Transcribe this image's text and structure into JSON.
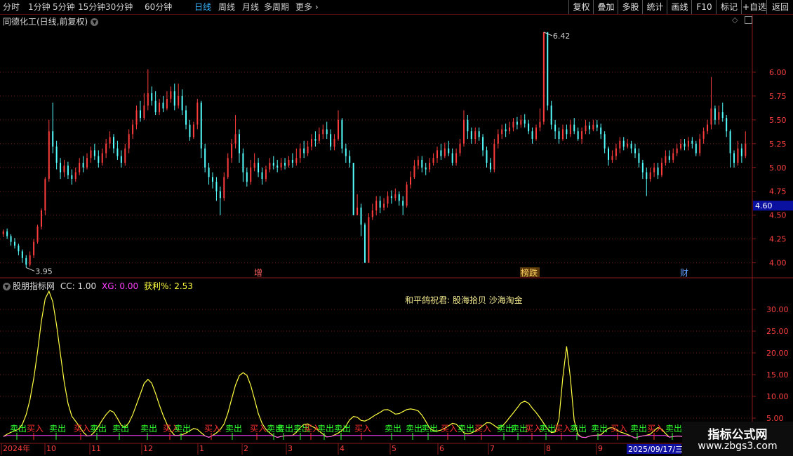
{
  "toolbar": {
    "periods": [
      "分时",
      "1分钟",
      "5分钟",
      "15分钟",
      "30分钟",
      "60分钟",
      "日线",
      "周线",
      "月线",
      "多周期",
      "更多"
    ],
    "active_period": "日线",
    "right_buttons": [
      "复权",
      "叠加",
      "多股",
      "统计",
      "画线",
      "F10",
      "标记",
      "+自选",
      "返回"
    ]
  },
  "chart_title": "同德化工(日线,前复权)",
  "price_axis": {
    "ticks": [
      "6.00",
      "5.75",
      "5.50",
      "5.25",
      "5.00",
      "4.75",
      "4.50",
      "4.25",
      "4.00"
    ],
    "tick_values": [
      6.0,
      5.75,
      5.5,
      5.25,
      5.0,
      4.75,
      4.5,
      4.25,
      4.0
    ],
    "current_price_label": "4.60",
    "current_price": 4.6
  },
  "markers": {
    "high": "6.42",
    "low": "3.95",
    "events": [
      "增",
      "榜跌",
      "财"
    ]
  },
  "indicator": {
    "name": "股朋指标网",
    "cc_label": "CC: 1.00",
    "xg_label": "XG: 0.00",
    "profit_label": "获利%: 2.53",
    "annotation": "和平鸽祝君:  股海拾贝  沙海淘金",
    "axis_ticks": [
      "30.00",
      "25.00",
      "20.00",
      "15.00",
      "10.00",
      "5.00"
    ],
    "axis_values": [
      30,
      25,
      20,
      15,
      10,
      5
    ],
    "buy_label": "买入",
    "sell_label": "卖出"
  },
  "date_axis": {
    "labels": [
      "2024年",
      "10",
      "11",
      "12",
      "1",
      "2",
      "3",
      "4",
      "5",
      "6",
      "7",
      "8",
      "9"
    ],
    "cursor_date": "2025/09/17/三"
  },
  "watermark": {
    "line1": "指标公式网",
    "line2": "www.zbgs3.com"
  },
  "colors": {
    "up": "#ff3d3d",
    "down": "#54ffff",
    "indicator_line": "#ffff40",
    "buy": "#ff3030",
    "sell": "#30ff30",
    "grid": "#7a1a1a",
    "axis_text": "#ff4040",
    "price_box": "#0a10a0"
  },
  "chart_data": {
    "type": "candlestick",
    "price_ylim": [
      3.85,
      6.5
    ],
    "indicator_ylim": [
      0,
      35
    ],
    "candles": [
      [
        4.3,
        4.33,
        4.35,
        4.27
      ],
      [
        4.33,
        4.28,
        4.36,
        4.25
      ],
      [
        4.28,
        4.22,
        4.3,
        4.18
      ],
      [
        4.22,
        4.18,
        4.26,
        4.15
      ],
      [
        4.18,
        4.12,
        4.2,
        4.08
      ],
      [
        4.12,
        4.05,
        4.14,
        4.0
      ],
      [
        4.05,
        3.98,
        4.08,
        3.95
      ],
      [
        3.98,
        4.08,
        4.12,
        3.96
      ],
      [
        4.08,
        4.22,
        4.25,
        4.05
      ],
      [
        4.22,
        4.38,
        4.4,
        4.2
      ],
      [
        4.38,
        4.55,
        4.57,
        4.35
      ],
      [
        4.55,
        4.88,
        4.9,
        4.5
      ],
      [
        4.88,
        5.38,
        5.5,
        4.85
      ],
      [
        5.38,
        5.22,
        5.68,
        5.15
      ],
      [
        5.22,
        5.05,
        5.28,
        4.98
      ],
      [
        5.05,
        4.95,
        5.1,
        4.88
      ],
      [
        4.95,
        5.02,
        5.08,
        4.9
      ],
      [
        5.02,
        4.92,
        5.06,
        4.88
      ],
      [
        4.92,
        4.88,
        4.98,
        4.82
      ],
      [
        4.88,
        4.95,
        5.0,
        4.85
      ],
      [
        4.95,
        5.05,
        5.1,
        4.92
      ],
      [
        5.05,
        5.0,
        5.12,
        4.95
      ],
      [
        5.0,
        5.1,
        5.15,
        4.98
      ],
      [
        5.1,
        5.18,
        5.22,
        5.05
      ],
      [
        5.18,
        5.12,
        5.25,
        5.08
      ],
      [
        5.12,
        5.05,
        5.18,
        5.0
      ],
      [
        5.05,
        5.15,
        5.2,
        5.02
      ],
      [
        5.15,
        5.25,
        5.3,
        5.1
      ],
      [
        5.25,
        5.32,
        5.38,
        5.2
      ],
      [
        5.32,
        5.2,
        5.35,
        5.15
      ],
      [
        5.2,
        5.12,
        5.28,
        5.08
      ],
      [
        5.12,
        5.05,
        5.18,
        5.0
      ],
      [
        5.05,
        5.2,
        5.25,
        5.02
      ],
      [
        5.2,
        5.35,
        5.4,
        5.15
      ],
      [
        5.35,
        5.45,
        5.5,
        5.3
      ],
      [
        5.45,
        5.6,
        5.65,
        5.4
      ],
      [
        5.6,
        5.52,
        5.7,
        5.48
      ],
      [
        5.52,
        5.65,
        5.78,
        5.5
      ],
      [
        5.65,
        5.78,
        6.03,
        5.6
      ],
      [
        5.78,
        5.7,
        5.85,
        5.65
      ],
      [
        5.7,
        5.58,
        5.8,
        5.55
      ],
      [
        5.58,
        5.68,
        5.72,
        5.55
      ],
      [
        5.68,
        5.62,
        5.75,
        5.58
      ],
      [
        5.62,
        5.72,
        5.8,
        5.6
      ],
      [
        5.72,
        5.8,
        5.85,
        5.68
      ],
      [
        5.8,
        5.65,
        5.88,
        5.6
      ],
      [
        5.65,
        5.75,
        5.88,
        5.62
      ],
      [
        5.75,
        5.6,
        5.82,
        5.55
      ],
      [
        5.6,
        5.45,
        5.65,
        5.4
      ],
      [
        5.45,
        5.32,
        5.5,
        5.28
      ],
      [
        5.32,
        5.45,
        5.48,
        5.3
      ],
      [
        5.45,
        5.68,
        5.72,
        5.4
      ],
      [
        5.68,
        5.2,
        5.7,
        5.1
      ],
      [
        5.2,
        5.0,
        5.25,
        4.95
      ],
      [
        5.0,
        4.9,
        5.05,
        4.82
      ],
      [
        4.9,
        4.85,
        4.95,
        4.78
      ],
      [
        4.85,
        4.75,
        4.9,
        4.65
      ],
      [
        4.75,
        4.68,
        4.8,
        4.5
      ],
      [
        4.68,
        4.9,
        4.95,
        4.65
      ],
      [
        4.9,
        5.1,
        5.15,
        4.88
      ],
      [
        5.1,
        5.25,
        5.3,
        5.05
      ],
      [
        5.25,
        5.35,
        5.55,
        5.2
      ],
      [
        5.35,
        5.15,
        5.4,
        5.05
      ],
      [
        5.15,
        4.95,
        5.2,
        4.85
      ],
      [
        4.95,
        4.85,
        5.0,
        4.8
      ],
      [
        4.85,
        5.0,
        5.08,
        4.82
      ],
      [
        5.0,
        5.05,
        5.15,
        4.96
      ],
      [
        5.05,
        4.95,
        5.1,
        4.9
      ],
      [
        4.95,
        4.88,
        5.0,
        4.82
      ],
      [
        4.88,
        4.98,
        5.02,
        4.85
      ],
      [
        4.98,
        5.05,
        5.1,
        4.95
      ],
      [
        5.05,
        5.02,
        5.12,
        4.98
      ],
      [
        5.02,
        5.0,
        5.08,
        4.95
      ],
      [
        5.0,
        5.05,
        5.1,
        4.97
      ],
      [
        5.05,
        5.02,
        5.1,
        4.98
      ],
      [
        5.02,
        5.08,
        5.12,
        5.0
      ],
      [
        5.08,
        5.05,
        5.15,
        5.0
      ],
      [
        5.05,
        5.1,
        5.2,
        5.02
      ],
      [
        5.1,
        5.2,
        5.25,
        5.05
      ],
      [
        5.2,
        5.15,
        5.28,
        5.1
      ],
      [
        5.15,
        5.22,
        5.28,
        5.12
      ],
      [
        5.22,
        5.3,
        5.35,
        5.18
      ],
      [
        5.3,
        5.28,
        5.38,
        5.22
      ],
      [
        5.28,
        5.35,
        5.42,
        5.25
      ],
      [
        5.35,
        5.4,
        5.45,
        5.3
      ],
      [
        5.4,
        5.35,
        5.48,
        5.3
      ],
      [
        5.35,
        5.22,
        5.4,
        5.18
      ],
      [
        5.22,
        5.3,
        5.35,
        5.18
      ],
      [
        5.3,
        5.5,
        5.6,
        5.28
      ],
      [
        5.5,
        5.2,
        5.52,
        5.15
      ],
      [
        5.2,
        5.12,
        5.25,
        5.05
      ],
      [
        5.12,
        5.05,
        5.18,
        5.0
      ],
      [
        5.05,
        4.5,
        5.05,
        4.5
      ],
      [
        4.5,
        4.58,
        4.72,
        4.5
      ],
      [
        4.58,
        4.4,
        4.62,
        4.28
      ],
      [
        4.4,
        4.0,
        4.42,
        4.0
      ],
      [
        4.0,
        4.48,
        4.52,
        4.0
      ],
      [
        4.48,
        4.55,
        4.62,
        4.45
      ],
      [
        4.55,
        4.65,
        4.7,
        4.5
      ],
      [
        4.65,
        4.58,
        4.7,
        4.52
      ],
      [
        4.58,
        4.62,
        4.68,
        4.55
      ],
      [
        4.62,
        4.7,
        4.75,
        4.58
      ],
      [
        4.7,
        4.68,
        4.76,
        4.62
      ],
      [
        4.68,
        4.72,
        4.78,
        4.65
      ],
      [
        4.72,
        4.65,
        4.75,
        4.6
      ],
      [
        4.65,
        4.6,
        4.7,
        4.5
      ],
      [
        4.6,
        4.82,
        4.85,
        4.58
      ],
      [
        4.82,
        4.9,
        4.96,
        4.78
      ],
      [
        4.9,
        5.02,
        5.08,
        4.88
      ],
      [
        5.02,
        5.08,
        5.12,
        4.98
      ],
      [
        5.08,
        5.0,
        5.12,
        4.95
      ],
      [
        5.0,
        4.98,
        5.05,
        4.92
      ],
      [
        4.98,
        5.05,
        5.1,
        4.95
      ],
      [
        5.05,
        5.1,
        5.15,
        5.02
      ],
      [
        5.1,
        5.18,
        5.22,
        5.05
      ],
      [
        5.18,
        5.12,
        5.25,
        5.08
      ],
      [
        5.12,
        5.2,
        5.26,
        5.1
      ],
      [
        5.2,
        5.15,
        5.28,
        5.12
      ],
      [
        5.15,
        5.05,
        5.2,
        5.02
      ],
      [
        5.05,
        5.15,
        5.2,
        5.02
      ],
      [
        5.15,
        5.25,
        5.3,
        5.12
      ],
      [
        5.25,
        5.5,
        5.6,
        5.22
      ],
      [
        5.5,
        5.38,
        5.55,
        5.3
      ],
      [
        5.38,
        5.3,
        5.42,
        5.25
      ],
      [
        5.3,
        5.38,
        5.42,
        5.25
      ],
      [
        5.38,
        5.32,
        5.42,
        5.28
      ],
      [
        5.32,
        5.18,
        5.35,
        5.12
      ],
      [
        5.18,
        5.05,
        5.22,
        5.0
      ],
      [
        5.05,
        4.98,
        5.1,
        4.95
      ],
      [
        4.98,
        5.25,
        5.3,
        4.95
      ],
      [
        5.25,
        5.35,
        5.4,
        5.2
      ],
      [
        5.35,
        5.4,
        5.45,
        5.3
      ],
      [
        5.4,
        5.38,
        5.46,
        5.32
      ],
      [
        5.38,
        5.42,
        5.48,
        5.35
      ],
      [
        5.42,
        5.48,
        5.52,
        5.38
      ],
      [
        5.48,
        5.45,
        5.53,
        5.4
      ],
      [
        5.45,
        5.5,
        5.55,
        5.42
      ],
      [
        5.5,
        5.46,
        5.56,
        5.42
      ],
      [
        5.46,
        5.38,
        5.5,
        5.35
      ],
      [
        5.38,
        5.3,
        5.42,
        5.25
      ],
      [
        5.3,
        5.42,
        5.45,
        5.28
      ],
      [
        5.42,
        5.48,
        5.62,
        5.38
      ],
      [
        5.48,
        6.42,
        6.42,
        5.45
      ],
      [
        6.42,
        5.65,
        6.42,
        5.6
      ],
      [
        5.65,
        5.45,
        5.7,
        5.4
      ],
      [
        5.45,
        5.38,
        5.5,
        5.3
      ],
      [
        5.38,
        5.3,
        5.42,
        5.25
      ],
      [
        5.3,
        5.4,
        5.45,
        5.28
      ],
      [
        5.4,
        5.35,
        5.45,
        5.3
      ],
      [
        5.35,
        5.45,
        5.5,
        5.32
      ],
      [
        5.45,
        5.38,
        5.52,
        5.35
      ],
      [
        5.38,
        5.3,
        5.42,
        5.28
      ],
      [
        5.3,
        5.38,
        5.42,
        5.25
      ],
      [
        5.38,
        5.44,
        5.5,
        5.35
      ],
      [
        5.44,
        5.4,
        5.48,
        5.35
      ],
      [
        5.4,
        5.45,
        5.5,
        5.38
      ],
      [
        5.45,
        5.42,
        5.5,
        5.38
      ],
      [
        5.42,
        5.35,
        5.46,
        5.3
      ],
      [
        5.35,
        5.2,
        5.38,
        5.15
      ],
      [
        5.2,
        5.08,
        5.22,
        5.02
      ],
      [
        5.08,
        5.12,
        5.18,
        5.05
      ],
      [
        5.12,
        5.2,
        5.25,
        5.08
      ],
      [
        5.2,
        5.28,
        5.32,
        5.15
      ],
      [
        5.28,
        5.22,
        5.32,
        5.18
      ],
      [
        5.22,
        5.25,
        5.3,
        5.2
      ],
      [
        5.25,
        5.2,
        5.28,
        5.15
      ],
      [
        5.2,
        5.15,
        5.25,
        5.1
      ],
      [
        5.15,
        5.05,
        5.2,
        5.0
      ],
      [
        5.05,
        4.95,
        5.08,
        4.88
      ],
      [
        4.95,
        4.88,
        5.0,
        4.7
      ],
      [
        4.88,
        4.95,
        5.0,
        4.85
      ],
      [
        4.95,
        5.0,
        5.05,
        4.9
      ],
      [
        5.0,
        4.92,
        5.05,
        4.88
      ],
      [
        4.92,
        5.05,
        5.1,
        4.9
      ],
      [
        5.05,
        5.12,
        5.18,
        5.02
      ],
      [
        5.12,
        5.08,
        5.18,
        5.05
      ],
      [
        5.08,
        5.15,
        5.2,
        5.05
      ],
      [
        5.15,
        5.2,
        5.25,
        5.12
      ],
      [
        5.2,
        5.25,
        5.3,
        5.18
      ],
      [
        5.25,
        5.22,
        5.3,
        5.18
      ],
      [
        5.22,
        5.28,
        5.32,
        5.18
      ],
      [
        5.28,
        5.25,
        5.32,
        5.2
      ],
      [
        5.25,
        5.15,
        5.28,
        5.12
      ],
      [
        5.15,
        5.3,
        5.35,
        5.12
      ],
      [
        5.3,
        5.38,
        5.42,
        5.25
      ],
      [
        5.38,
        5.45,
        5.5,
        5.35
      ],
      [
        5.45,
        5.62,
        5.95,
        5.4
      ],
      [
        5.62,
        5.5,
        5.65,
        5.45
      ],
      [
        5.5,
        5.58,
        5.65,
        5.45
      ],
      [
        5.58,
        5.52,
        5.68,
        5.48
      ],
      [
        5.52,
        5.38,
        5.55,
        5.32
      ],
      [
        5.38,
        5.15,
        5.4,
        5.0
      ],
      [
        5.15,
        5.05,
        5.18,
        5.0
      ],
      [
        5.05,
        5.2,
        5.28,
        5.02
      ],
      [
        5.2,
        5.12,
        5.25,
        5.05
      ],
      [
        5.12,
        5.25,
        5.38,
        5.1
      ]
    ],
    "indicator_peaks": [
      [
        6,
        1.5,
        5
      ],
      [
        12,
        33,
        4
      ],
      [
        19,
        2,
        2
      ],
      [
        28,
        6,
        3
      ],
      [
        38,
        13,
        4
      ],
      [
        50,
        2,
        2
      ],
      [
        63,
        15,
        4
      ],
      [
        80,
        3,
        3
      ],
      [
        92,
        4,
        3
      ],
      [
        100,
        6,
        5
      ],
      [
        108,
        6,
        4
      ],
      [
        118,
        3,
        3
      ],
      [
        127,
        3,
        3
      ],
      [
        137,
        8,
        5
      ],
      [
        148,
        21,
        1.5
      ],
      [
        160,
        2,
        3
      ],
      [
        172,
        2,
        2
      ],
      [
        186,
        3,
        3
      ],
      [
        196,
        2,
        2
      ]
    ]
  }
}
